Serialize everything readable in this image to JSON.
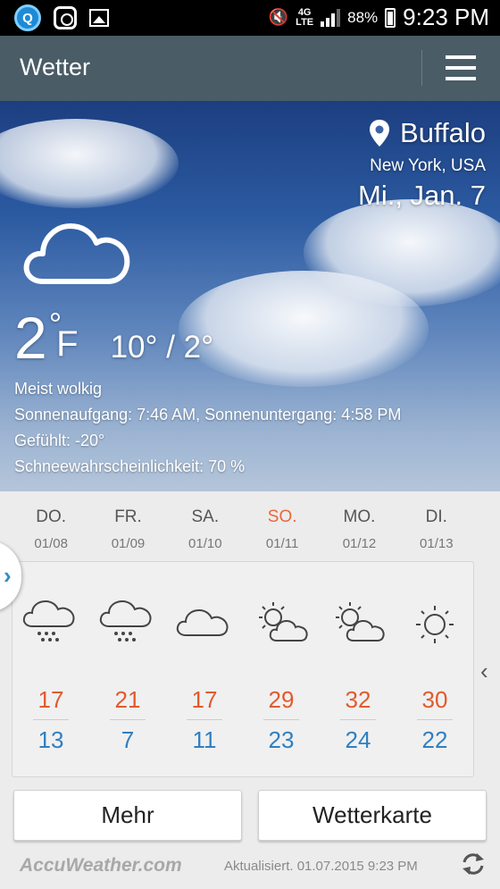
{
  "status_bar": {
    "battery": "88%",
    "network": "4G",
    "network_sub": "LTE",
    "time": "9:23 PM",
    "icons": [
      "app-notification-icon",
      "instagram-icon",
      "gallery-icon",
      "mute-icon",
      "signal-icon",
      "battery-icon"
    ]
  },
  "header": {
    "title": "Wetter"
  },
  "current": {
    "city": "Buffalo",
    "region": "New York, USA",
    "date": "Mi., Jan. 7",
    "temp": "2",
    "deg": "°",
    "unit": "F",
    "range": "10° / 2°",
    "condition": "Meist wolkig",
    "sun": "Sonnenaufgang: 7:46  AM, Sonnenuntergang: 4:58  PM",
    "feels": "Gefühlt: -20°",
    "snow": "Schneewahrscheinlichkeit: 70 %"
  },
  "forecast": [
    {
      "day": "DO.",
      "date": "01/08",
      "icon": "snow-cloud",
      "high": "17",
      "low": "13"
    },
    {
      "day": "FR.",
      "date": "01/09",
      "icon": "snow-cloud",
      "high": "21",
      "low": "7"
    },
    {
      "day": "SA.",
      "date": "01/10",
      "icon": "cloud",
      "high": "17",
      "low": "11"
    },
    {
      "day": "SO.",
      "date": "01/11",
      "icon": "partly-sunny",
      "high": "29",
      "low": "23"
    },
    {
      "day": "MO.",
      "date": "01/12",
      "icon": "partly-sunny",
      "high": "32",
      "low": "24"
    },
    {
      "day": "DI.",
      "date": "01/13",
      "icon": "sunny",
      "high": "30",
      "low": "22"
    }
  ],
  "buttons": {
    "more": "Mehr",
    "map": "Wetterkarte"
  },
  "footer": {
    "brand": "AccuWeather.com",
    "updated": "Aktualisiert. 01.07.2015 9:23 PM"
  },
  "colors": {
    "high": "#e25a2c",
    "low": "#2f7fc2",
    "sunday": "#e9683a",
    "header": "#4a5c66"
  }
}
